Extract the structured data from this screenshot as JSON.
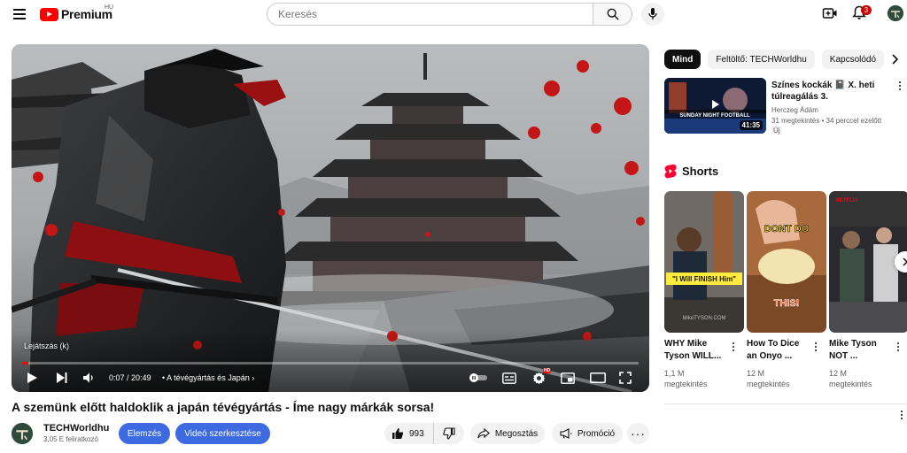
{
  "header": {
    "logo_text": "Premium",
    "country_code": "HU",
    "search_placeholder": "Keresés",
    "notification_count": "3"
  },
  "player": {
    "tooltip": "Lejátszás (k)",
    "current_time": "0:07",
    "duration": "20:49",
    "time_display": "0:07 / 20:49",
    "chapter": "• A tévégyártás és Japán",
    "progress": 0.006,
    "quality_badge": "HD"
  },
  "video": {
    "title": "A szemünk előtt haldoklik a japán tévégyártás - Íme nagy márkák sorsa!",
    "channel_name": "TECHWorldhu",
    "subscribers": "3,05 E feliratkozó",
    "analytics_label": "Elemzés",
    "edit_label": "Videó szerkesztése",
    "like_count": "993",
    "share_label": "Megosztás",
    "promote_label": "Promóció"
  },
  "sidebar": {
    "chips": [
      {
        "label": "Mind"
      },
      {
        "label": "Feltöltő: TECHWorldhu"
      },
      {
        "label": "Kapcsolódó"
      }
    ],
    "recommendation": {
      "title": "Színes kockák 📓 X. heti túlreagálás 3.",
      "channel": "Herczeg Ádám",
      "stats": "31 megtekintés • 34 perccel ezelőtt",
      "badge": "Új",
      "duration": "41:35",
      "thumb_text": "SUNDAY NIGHT FOOTBALL"
    },
    "shorts_heading": "Shorts",
    "shorts": [
      {
        "title": "WHY Mike Tyson WILL...",
        "views": "1,1 M megtekintés",
        "overlay": "\"I Will FINISH Him\"",
        "watermark": "MikeTYSON.COM"
      },
      {
        "title": "How To Dice an Onyo ...",
        "views": "12 M megtekintés",
        "overlay_top": "DONT DO",
        "overlay_bottom": "THIS!"
      },
      {
        "title": "Mike Tyson NOT ...",
        "views": "12 M megtekintés",
        "overlay": "NETFLIX"
      }
    ]
  }
}
